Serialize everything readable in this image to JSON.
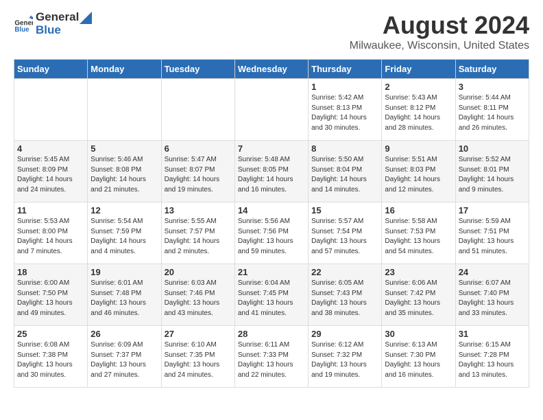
{
  "logo": {
    "general": "General",
    "blue": "Blue"
  },
  "header": {
    "title": "August 2024",
    "subtitle": "Milwaukee, Wisconsin, United States"
  },
  "days_of_week": [
    "Sunday",
    "Monday",
    "Tuesday",
    "Wednesday",
    "Thursday",
    "Friday",
    "Saturday"
  ],
  "weeks": [
    [
      {
        "day": "",
        "info": ""
      },
      {
        "day": "",
        "info": ""
      },
      {
        "day": "",
        "info": ""
      },
      {
        "day": "",
        "info": ""
      },
      {
        "day": "1",
        "info": "Sunrise: 5:42 AM\nSunset: 8:13 PM\nDaylight: 14 hours\nand 30 minutes."
      },
      {
        "day": "2",
        "info": "Sunrise: 5:43 AM\nSunset: 8:12 PM\nDaylight: 14 hours\nand 28 minutes."
      },
      {
        "day": "3",
        "info": "Sunrise: 5:44 AM\nSunset: 8:11 PM\nDaylight: 14 hours\nand 26 minutes."
      }
    ],
    [
      {
        "day": "4",
        "info": "Sunrise: 5:45 AM\nSunset: 8:09 PM\nDaylight: 14 hours\nand 24 minutes."
      },
      {
        "day": "5",
        "info": "Sunrise: 5:46 AM\nSunset: 8:08 PM\nDaylight: 14 hours\nand 21 minutes."
      },
      {
        "day": "6",
        "info": "Sunrise: 5:47 AM\nSunset: 8:07 PM\nDaylight: 14 hours\nand 19 minutes."
      },
      {
        "day": "7",
        "info": "Sunrise: 5:48 AM\nSunset: 8:05 PM\nDaylight: 14 hours\nand 16 minutes."
      },
      {
        "day": "8",
        "info": "Sunrise: 5:50 AM\nSunset: 8:04 PM\nDaylight: 14 hours\nand 14 minutes."
      },
      {
        "day": "9",
        "info": "Sunrise: 5:51 AM\nSunset: 8:03 PM\nDaylight: 14 hours\nand 12 minutes."
      },
      {
        "day": "10",
        "info": "Sunrise: 5:52 AM\nSunset: 8:01 PM\nDaylight: 14 hours\nand 9 minutes."
      }
    ],
    [
      {
        "day": "11",
        "info": "Sunrise: 5:53 AM\nSunset: 8:00 PM\nDaylight: 14 hours\nand 7 minutes."
      },
      {
        "day": "12",
        "info": "Sunrise: 5:54 AM\nSunset: 7:59 PM\nDaylight: 14 hours\nand 4 minutes."
      },
      {
        "day": "13",
        "info": "Sunrise: 5:55 AM\nSunset: 7:57 PM\nDaylight: 14 hours\nand 2 minutes."
      },
      {
        "day": "14",
        "info": "Sunrise: 5:56 AM\nSunset: 7:56 PM\nDaylight: 13 hours\nand 59 minutes."
      },
      {
        "day": "15",
        "info": "Sunrise: 5:57 AM\nSunset: 7:54 PM\nDaylight: 13 hours\nand 57 minutes."
      },
      {
        "day": "16",
        "info": "Sunrise: 5:58 AM\nSunset: 7:53 PM\nDaylight: 13 hours\nand 54 minutes."
      },
      {
        "day": "17",
        "info": "Sunrise: 5:59 AM\nSunset: 7:51 PM\nDaylight: 13 hours\nand 51 minutes."
      }
    ],
    [
      {
        "day": "18",
        "info": "Sunrise: 6:00 AM\nSunset: 7:50 PM\nDaylight: 13 hours\nand 49 minutes."
      },
      {
        "day": "19",
        "info": "Sunrise: 6:01 AM\nSunset: 7:48 PM\nDaylight: 13 hours\nand 46 minutes."
      },
      {
        "day": "20",
        "info": "Sunrise: 6:03 AM\nSunset: 7:46 PM\nDaylight: 13 hours\nand 43 minutes."
      },
      {
        "day": "21",
        "info": "Sunrise: 6:04 AM\nSunset: 7:45 PM\nDaylight: 13 hours\nand 41 minutes."
      },
      {
        "day": "22",
        "info": "Sunrise: 6:05 AM\nSunset: 7:43 PM\nDaylight: 13 hours\nand 38 minutes."
      },
      {
        "day": "23",
        "info": "Sunrise: 6:06 AM\nSunset: 7:42 PM\nDaylight: 13 hours\nand 35 minutes."
      },
      {
        "day": "24",
        "info": "Sunrise: 6:07 AM\nSunset: 7:40 PM\nDaylight: 13 hours\nand 33 minutes."
      }
    ],
    [
      {
        "day": "25",
        "info": "Sunrise: 6:08 AM\nSunset: 7:38 PM\nDaylight: 13 hours\nand 30 minutes."
      },
      {
        "day": "26",
        "info": "Sunrise: 6:09 AM\nSunset: 7:37 PM\nDaylight: 13 hours\nand 27 minutes."
      },
      {
        "day": "27",
        "info": "Sunrise: 6:10 AM\nSunset: 7:35 PM\nDaylight: 13 hours\nand 24 minutes."
      },
      {
        "day": "28",
        "info": "Sunrise: 6:11 AM\nSunset: 7:33 PM\nDaylight: 13 hours\nand 22 minutes."
      },
      {
        "day": "29",
        "info": "Sunrise: 6:12 AM\nSunset: 7:32 PM\nDaylight: 13 hours\nand 19 minutes."
      },
      {
        "day": "30",
        "info": "Sunrise: 6:13 AM\nSunset: 7:30 PM\nDaylight: 13 hours\nand 16 minutes."
      },
      {
        "day": "31",
        "info": "Sunrise: 6:15 AM\nSunset: 7:28 PM\nDaylight: 13 hours\nand 13 minutes."
      }
    ]
  ]
}
